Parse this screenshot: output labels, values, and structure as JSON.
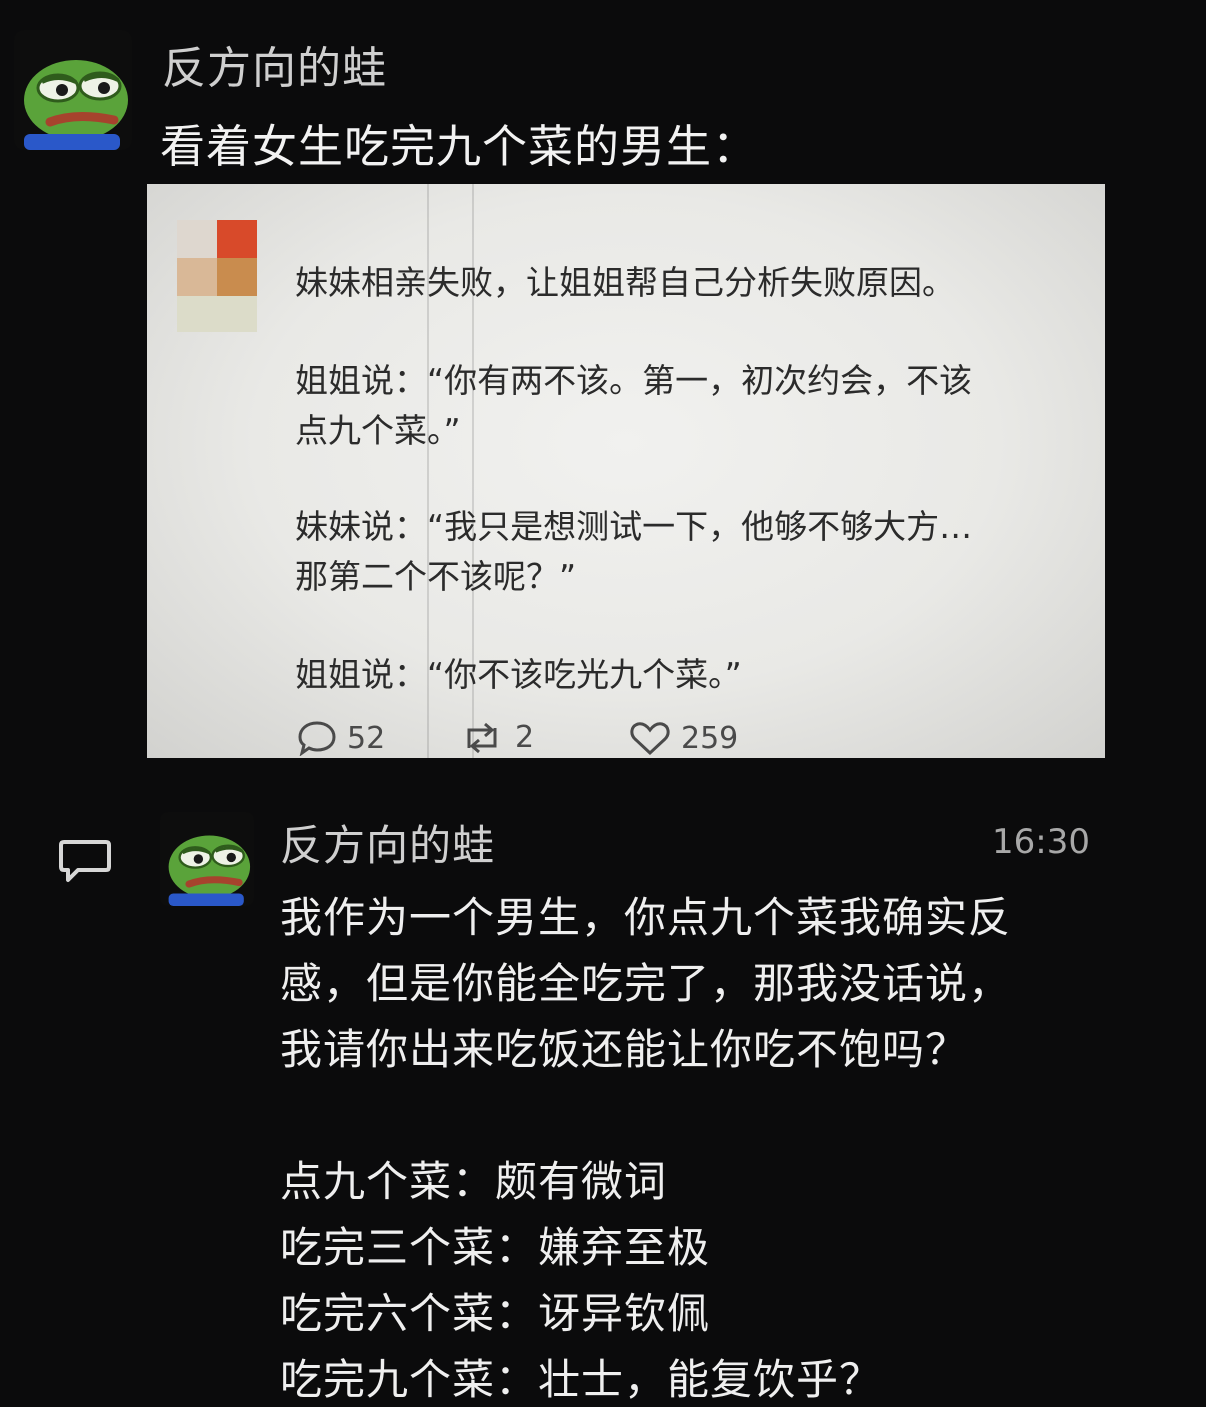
{
  "post": {
    "author": "反方向的蛙",
    "caption": "看着女生吃完九个菜的男生："
  },
  "screenshot": {
    "paragraphs": [
      "妹妹相亲失败，让姐姐帮自己分析失败原因。",
      "姐姐说：“你有两不该。第一，初次约会，不该",
      "点九个菜。”",
      "妹妹说：“我只是想测试一下，他够不够大方…",
      "那第二个不该呢？”",
      "姐姐说：“你不该吃光九个菜。”"
    ],
    "stats": {
      "comments": "52",
      "reposts": "2",
      "likes": "259"
    }
  },
  "reply": {
    "author": "反方向的蛙",
    "time": "16:30",
    "lines": [
      "我作为一个男生，你点九个菜我确实反",
      "感，但是你能全吃完了，那我没话说，",
      "我请你出来吃饭还能让你吃不饱吗？",
      "点九个菜：颇有微词",
      "吃完三个菜：嫌弃至极",
      "吃完六个菜：讶异钦佩",
      "吃完九个菜：壮士，能复饮乎？"
    ]
  },
  "icons": {
    "avatar": "pepe-frog-avatar",
    "comment": "comment-bubble-icon",
    "repost": "repost-icon",
    "like": "heart-icon"
  }
}
